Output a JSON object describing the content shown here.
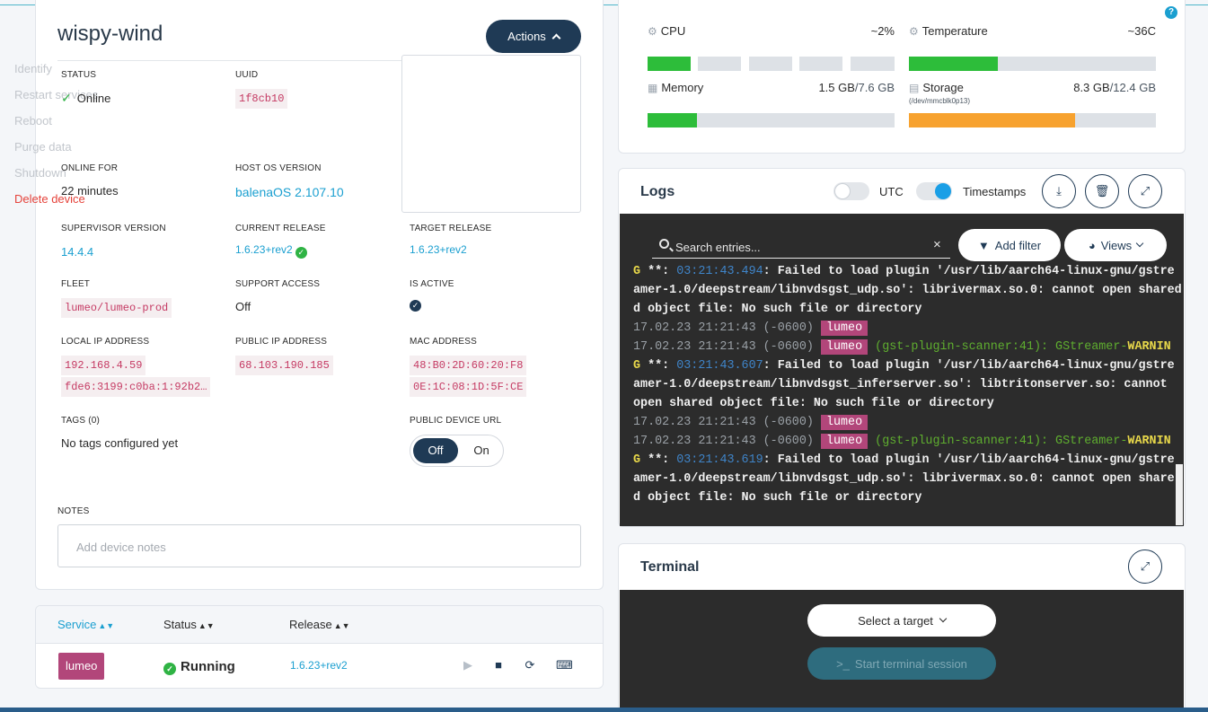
{
  "device": {
    "name": "wispy-wind",
    "actions_label": "Actions",
    "actions_menu": [
      "Identify",
      "Restart services",
      "Reboot",
      "Purge data",
      "Shutdown",
      "Delete device"
    ],
    "fields": {
      "status_label": "STATUS",
      "status_value": "Online",
      "uuid_label": "UUID",
      "uuid_value": "1f8cb10",
      "online_for_label": "ONLINE FOR",
      "online_for_value": "22 minutes",
      "host_os_label": "HOST OS VERSION",
      "host_os_value": "balenaOS 2.107.10",
      "supervisor_label": "SUPERVISOR VERSION",
      "supervisor_value": "14.4.4",
      "current_release_label": "CURRENT RELEASE",
      "current_release_value": "1.6.23+rev2",
      "target_release_label": "TARGET RELEASE",
      "target_release_value": "1.6.23+rev2",
      "fleet_label": "FLEET",
      "fleet_value": "lumeo/lumeo-prod",
      "support_label": "SUPPORT ACCESS",
      "support_value": "Off",
      "is_active_label": "IS ACTIVE",
      "local_ip_label": "LOCAL IP ADDRESS",
      "local_ip_1": "192.168.4.59",
      "local_ip_2": "fde6:3199:c0ba:1:92b2…",
      "public_ip_label": "PUBLIC IP ADDRESS",
      "public_ip_value": "68.103.190.185",
      "mac_label": "MAC ADDRESS",
      "mac_1": "48:B0:2D:60:20:F8",
      "mac_2": "0E:1C:08:1D:5F:CE",
      "tags_label": "TAGS (0)",
      "tags_value": "No tags configured yet",
      "public_url_label": "PUBLIC DEVICE URL",
      "public_url_off": "Off",
      "public_url_on": "On",
      "public_url_selected": "Off"
    },
    "notes_label": "NOTES",
    "notes_placeholder": "Add device notes"
  },
  "services": {
    "headers": [
      "Service",
      "Status",
      "Release"
    ],
    "rows": [
      {
        "service": "lumeo",
        "status": "Running",
        "release": "1.6.23+rev2"
      }
    ]
  },
  "metrics": {
    "cpu": {
      "label": "CPU",
      "value": "~2%",
      "level_pct": 2
    },
    "temperature": {
      "label": "Temperature",
      "value": "~36C",
      "level_pct": 36
    },
    "memory": {
      "label": "Memory",
      "used": "1.5 GB",
      "total": "/7.6 GB",
      "level_pct": 20
    },
    "storage": {
      "label": "Storage",
      "used": "8.3 GB",
      "total": "/12.4 GB",
      "sub": "(/dev/mmcblk0p13)",
      "level_pct": 67
    },
    "colors": {
      "ok": "#2dbd3a",
      "warn": "#f7a22f",
      "track": "#dde1e6"
    }
  },
  "logs": {
    "title": "Logs",
    "utc_label": "UTC",
    "utc_on": false,
    "timestamps_label": "Timestamps",
    "timestamps_on": true,
    "search_placeholder": "Search entries...",
    "add_filter_label": "Add filter",
    "views_label": "Views",
    "lines": [
      {
        "t": "G **: ",
        "blue": "03:21:43.494",
        "rest": ": Failed to load plugin '/usr/lib/aarch64-linux-gnu/gstre"
      },
      {
        "plain": "amer-1.0/deepstream/libnvdsgst_udp.so': librivermax.so.0: cannot open shared"
      },
      {
        "plain": "d object file: No such file or directory"
      },
      {
        "ts": "17.02.23 21:21:43 (-0600)",
        "tag": "lumeo"
      },
      {
        "ts": "17.02.23 21:21:43 (-0600)",
        "tag": "lumeo",
        "green": "(gst-plugin-scanner:41): GStreamer-",
        "warn": "WARNIN"
      },
      {
        "t": "G **: ",
        "blue": "03:21:43.607",
        "rest": ": Failed to load plugin '/usr/lib/aarch64-linux-gnu/gstre"
      },
      {
        "plain": "amer-1.0/deepstream/libnvdsgst_inferserver.so': libtritonserver.so: cannot"
      },
      {
        "plain": "open shared object file: No such file or directory"
      },
      {
        "ts": "17.02.23 21:21:43 (-0600)",
        "tag": "lumeo"
      },
      {
        "ts": "17.02.23 21:21:43 (-0600)",
        "tag": "lumeo",
        "green": "(gst-plugin-scanner:41): GStreamer-",
        "warn": "WARNIN"
      },
      {
        "t": "G **: ",
        "blue": "03:21:43.619",
        "rest": ": Failed to load plugin '/usr/lib/aarch64-linux-gnu/gstre"
      },
      {
        "plain": "amer-1.0/deepstream/libnvdsgst_udp.so': librivermax.so.0: cannot open share"
      },
      {
        "plain": "d object file: No such file or directory"
      }
    ]
  },
  "terminal": {
    "title": "Terminal",
    "select_target_label": "Select a target",
    "start_session_label": "Start terminal session"
  },
  "help_icon": "question-icon"
}
